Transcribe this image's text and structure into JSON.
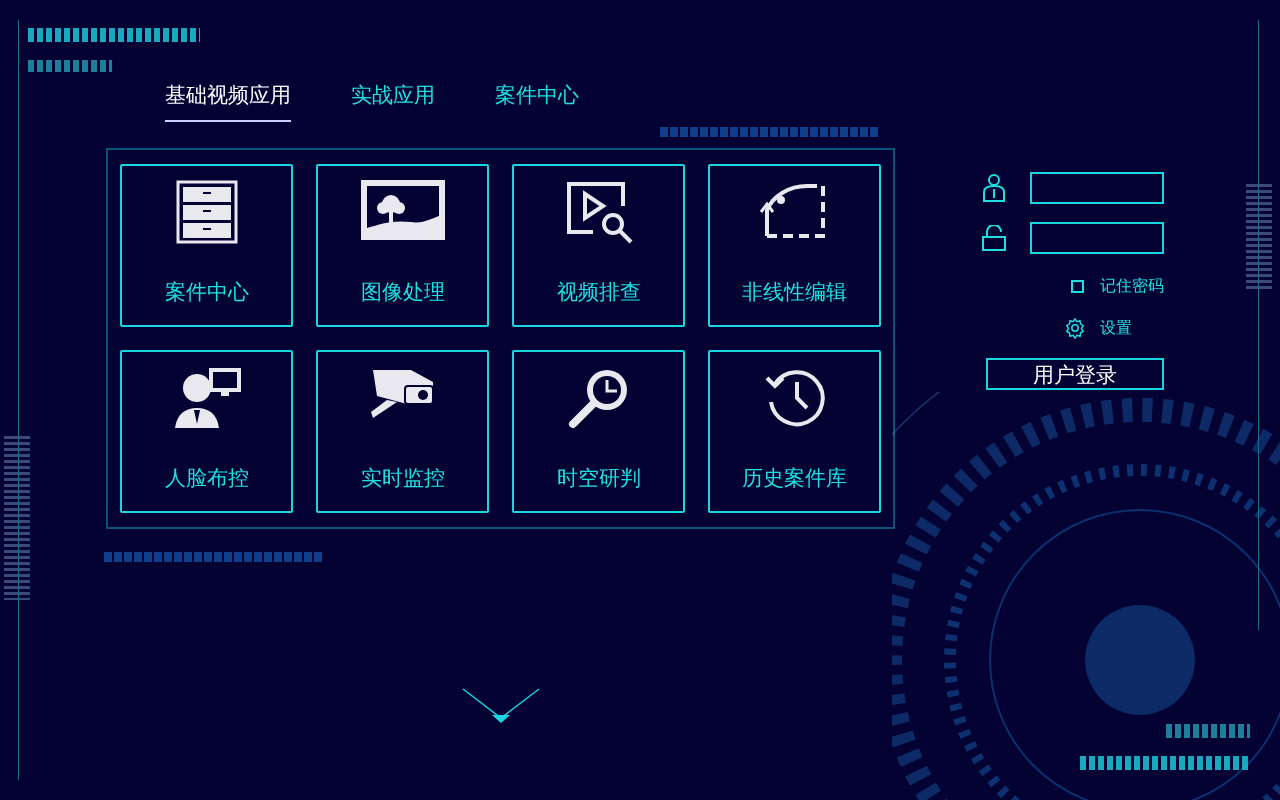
{
  "tabs": [
    {
      "label": "基础视频应用",
      "selected": true
    },
    {
      "label": "实战应用",
      "selected": false
    },
    {
      "label": "案件中心",
      "selected": false
    }
  ],
  "tiles": [
    {
      "kind": "cabinet",
      "label": "案件中心"
    },
    {
      "kind": "picture",
      "label": "图像处理"
    },
    {
      "kind": "video_search",
      "label": "视频排查"
    },
    {
      "kind": "curve",
      "label": "非线性编辑"
    },
    {
      "kind": "face",
      "label": "人脸布控"
    },
    {
      "kind": "camera",
      "label": "实时监控"
    },
    {
      "kind": "clock_search",
      "label": "时空研判"
    },
    {
      "kind": "history",
      "label": "历史案件库"
    }
  ],
  "login": {
    "remember": {
      "label": "记住密码",
      "checked": false
    },
    "settings": "设置",
    "button": "用户登录"
  }
}
